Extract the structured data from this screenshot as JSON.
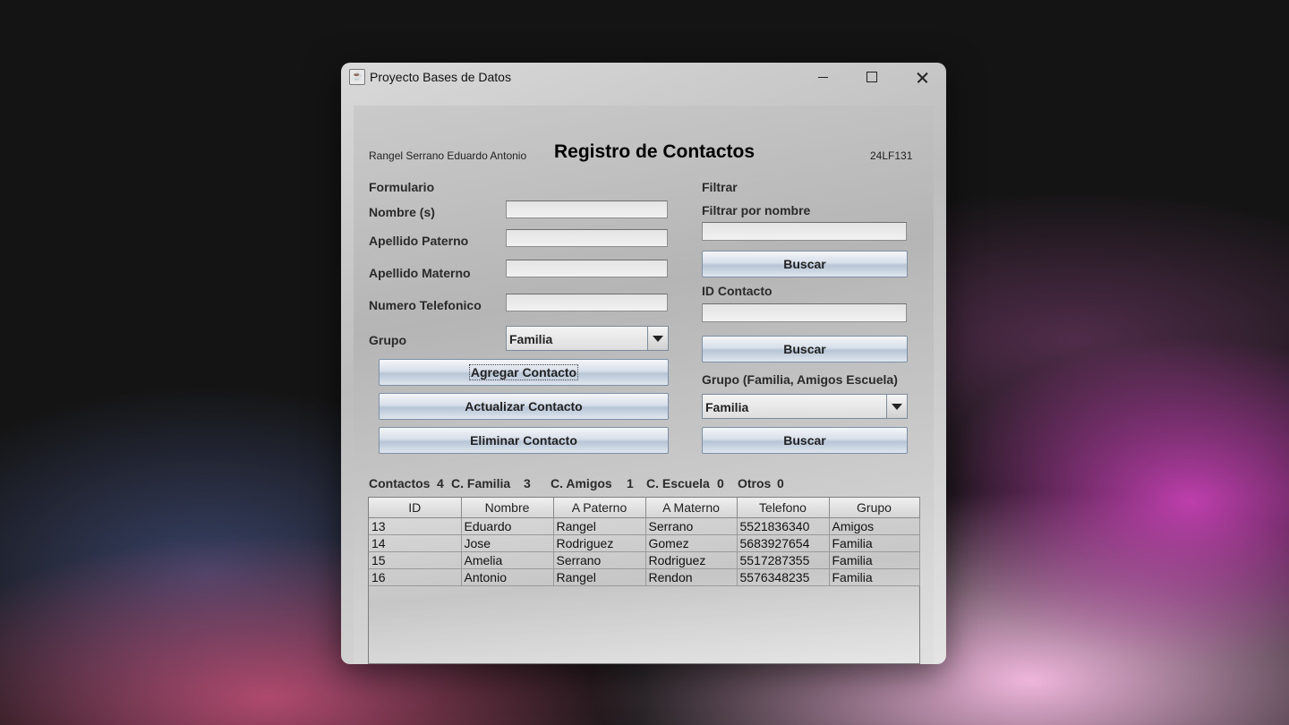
{
  "window": {
    "title": "Proyecto Bases de Datos"
  },
  "header": {
    "author": "Rangel Serrano Eduardo Antonio",
    "title": "Registro de Contactos",
    "code": "24LF131"
  },
  "form": {
    "section_label": "Formulario",
    "nombre_label": "Nombre (s)",
    "nombre_value": "",
    "paterno_label": "Apellido Paterno",
    "paterno_value": "",
    "materno_label": "Apellido Materno",
    "materno_value": "",
    "telefono_label": "Numero Telefonico",
    "telefono_value": "",
    "grupo_label": "Grupo",
    "grupo_selected": "Familia",
    "add_button": "Agregar Contacto",
    "update_button": "Actualizar Contacto",
    "delete_button": "Eliminar Contacto"
  },
  "filter": {
    "section_label": "Filtrar",
    "by_name_label": "Filtrar por nombre",
    "by_name_value": "",
    "search_name_button": "Buscar",
    "id_label": "ID Contacto",
    "id_value": "",
    "search_id_button": "Buscar",
    "group_label": "Grupo (Familia, Amigos Escuela)",
    "group_selected": "Familia",
    "search_group_button": "Buscar"
  },
  "stats": {
    "contactos_label": "Contactos",
    "contactos": "4",
    "familia_label": "C. Familia",
    "familia": "3",
    "amigos_label": "C. Amigos",
    "amigos": "1",
    "escuela_label": "C. Escuela",
    "escuela": "0",
    "otros_label": "Otros",
    "otros": "0"
  },
  "table": {
    "columns": [
      "ID",
      "Nombre",
      "A Paterno",
      "A Materno",
      "Telefono",
      "Grupo"
    ],
    "rows": [
      [
        "13",
        "Eduardo",
        "Rangel",
        "Serrano",
        "5521836340",
        "Amigos"
      ],
      [
        "14",
        "Jose",
        "Rodriguez",
        "Gomez",
        "5683927654",
        "Familia"
      ],
      [
        "15",
        "Amelia",
        "Serrano",
        "Rodriguez",
        "5517287355",
        "Familia"
      ],
      [
        "16",
        "Antonio",
        "Rangel",
        "Rendon",
        "5576348235",
        "Familia"
      ]
    ]
  }
}
